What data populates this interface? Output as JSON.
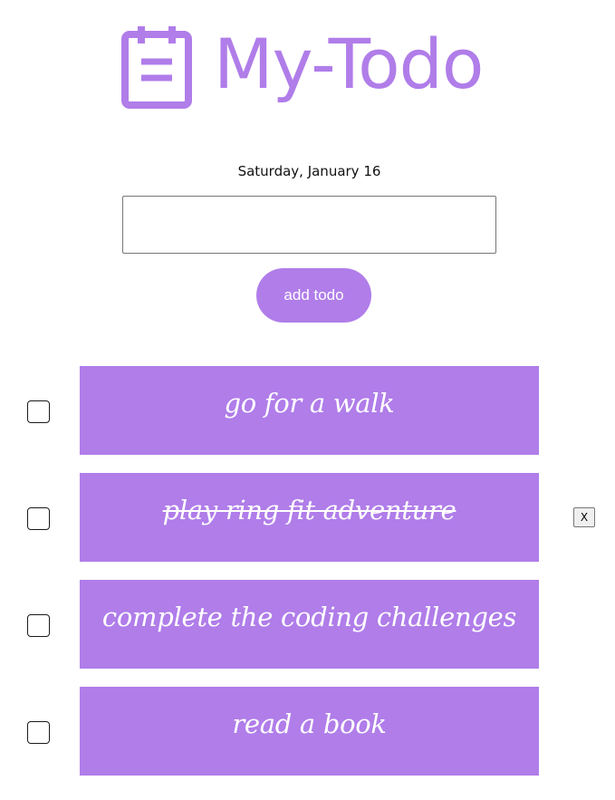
{
  "header": {
    "title": "My-Todo",
    "icon": "clipboard-icon",
    "accent_color": "#b07de9"
  },
  "date": "Saturday, January 16",
  "input": {
    "value": "",
    "placeholder": ""
  },
  "add_button": {
    "label": "add todo"
  },
  "todos": [
    {
      "text": "go for a walk",
      "completed": false,
      "checked": false,
      "show_delete": false
    },
    {
      "text": "play ring fit adventure",
      "completed": true,
      "checked": false,
      "show_delete": true,
      "delete_label": "X"
    },
    {
      "text": "complete the coding challenges",
      "completed": false,
      "checked": false,
      "show_delete": false
    },
    {
      "text": "read a book",
      "completed": false,
      "checked": false,
      "show_delete": false
    }
  ]
}
